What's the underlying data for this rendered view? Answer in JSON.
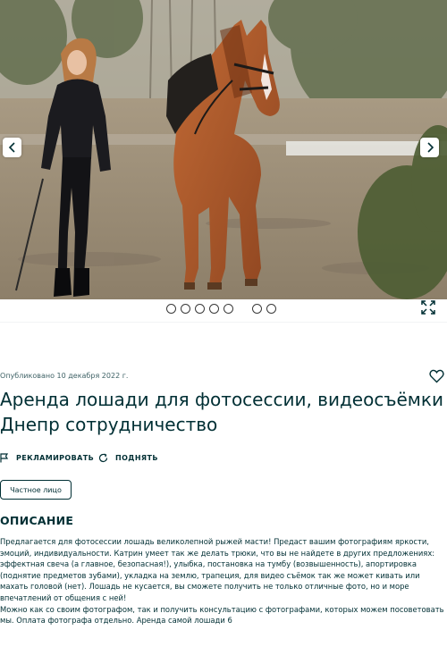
{
  "gallery": {
    "image_alt": "Женщина в чёрном ведёт рыжую лошадь по песчаной площадке",
    "active_slide": 1,
    "slides_count": 7
  },
  "published": "Опубликовано 10 декабря 2022 г.",
  "title": "Аренда лошади для фотосессии, видеосъёмки Днепр сотрудничество",
  "actions": {
    "promote": "РЕКЛАМИРОВАТЬ",
    "raise": "ПОДНЯТЬ"
  },
  "seller_type": "Частное лицо",
  "description": {
    "heading": "ОПИСАНИЕ",
    "text": "Предлагается для фотосессии лошадь великолепной рыжей масти! Предаст вашим фотографиям яркости, эмоций, индивидуальности. Катрин умеет так же делать трюки, что вы не найдете в других предложениях: эффектная свеча (а главное, безопасная!), улыбка, постановка на тумбу (возвышенность), апортировка (поднятие предметов зубами), укладка на землю, трапеция, для видео съёмок так же может кивать или махать головой (нет). Лошадь не кусается, вы сможете получить не только отличные фото, но и море впечатлений от общения с ней!\nМожно как со своим фотографом, так и получить консультацию с фотографами, которых можем посоветовать мы. Оплата фотографа отдельно. Аренда самой лошади 6"
  },
  "colors": {
    "text": "#002f34",
    "border": "#002f34",
    "muted": "#406367"
  },
  "icons": {
    "prev": "chevron-left-icon",
    "next": "chevron-right-icon",
    "fullscreen": "expand-icon",
    "favorite": "heart-icon",
    "promote": "flag-icon",
    "raise": "refresh-icon"
  }
}
